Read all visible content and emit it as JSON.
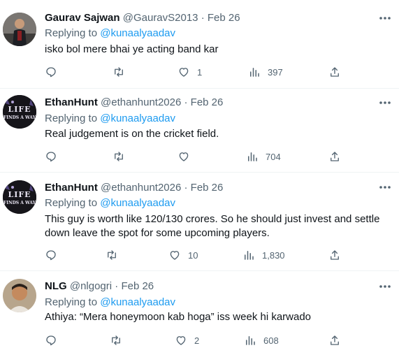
{
  "replies": [
    {
      "name": "Gaurav Sajwan",
      "handle": "@GauravS2013",
      "sep": "·",
      "date": "Feb 26",
      "replying_prefix": "Replying to ",
      "replying_to": "@kunaalyaadav",
      "text": [
        "isko bol mere bhai ye acting band kar"
      ],
      "counts": {
        "reply": "",
        "retweet": "",
        "like": "1",
        "views": "397"
      }
    },
    {
      "name": "EthanHunt",
      "handle": "@ethanhunt2026",
      "sep": "·",
      "date": "Feb 26",
      "replying_prefix": "Replying to ",
      "replying_to": "@kunaalyaadav",
      "text": [
        "Real judgement is on the cricket field."
      ],
      "counts": {
        "reply": "",
        "retweet": "",
        "like": "",
        "views": "704"
      }
    },
    {
      "name": "EthanHunt",
      "handle": "@ethanhunt2026",
      "sep": "·",
      "date": "Feb 26",
      "replying_prefix": "Replying to ",
      "replying_to": "@kunaalyaadav",
      "text": [
        "This guy is worth like 120/130 crores. So he should just invest and settle",
        "down leave the spot for some upcoming players."
      ],
      "counts": {
        "reply": "",
        "retweet": "",
        "like": "10",
        "views": "1,830"
      }
    },
    {
      "name": "NLG",
      "handle": "@nlgogri",
      "sep": "·",
      "date": "Feb 26",
      "replying_prefix": "Replying to ",
      "replying_to": "@kunaalyaadav",
      "text": [
        "Athiya: “Mera honeymoon kab hoga” iss week hi karwado"
      ],
      "counts": {
        "reply": "",
        "retweet": "",
        "like": "2",
        "views": "608"
      }
    }
  ],
  "avatar_texts": {
    "life": "LIFE",
    "finds": "FINDS A WAY"
  },
  "icons": {
    "more": "more-icon",
    "reply": "reply-icon",
    "retweet": "retweet-icon",
    "like": "heart-icon",
    "views": "views-icon",
    "share": "share-icon"
  },
  "colors": {
    "text": "#0f1419",
    "muted": "#536471",
    "link": "#1d9bf0",
    "divider": "#eff3f4"
  }
}
